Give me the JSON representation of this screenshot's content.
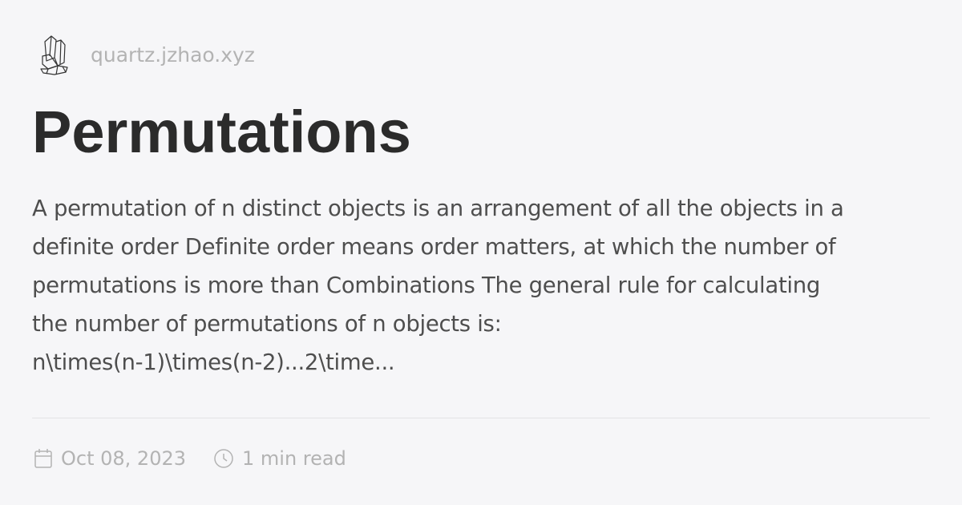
{
  "site": {
    "name": "quartz.jzhao.xyz",
    "logo": "crystal-icon"
  },
  "page": {
    "title": "Permutations",
    "description_lines": [
      "A permutation of n distinct objects is an arrangement of all the objects in a",
      "definite order Definite order means order matters, at which the number of",
      "permutations is more than Combinations The general rule for calculating",
      "the number of permutations of n objects is:",
      "n\\times(n-1)\\times(n-2)...2\\time..."
    ]
  },
  "meta": {
    "date": "Oct 08, 2023",
    "date_icon": "calendar-icon",
    "reading_time": "1 min read",
    "reading_icon": "clock-icon"
  }
}
